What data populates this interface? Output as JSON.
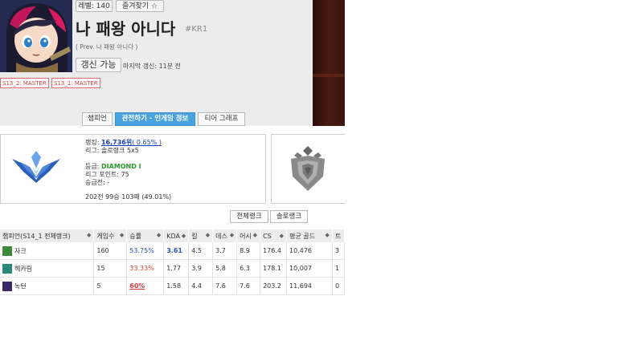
{
  "profile": {
    "level_label": "레벨: 140",
    "favorite_label": "즐겨찾기",
    "favorite_icon": "star-icon",
    "summoner_name": "나 패왕 아니다",
    "tag": "#KR1",
    "prev_name": "( Prev. 나 패왕 아니다 )",
    "refresh_label": "갱신 가능",
    "last_update": "마지막 갱신: 11분 전",
    "season_badges": [
      "S13_2: MASTER",
      "S13_1: MASTER"
    ]
  },
  "tabs": [
    "챔피언",
    "관전하기 - 인게임 정보",
    "티어 그래프"
  ],
  "rank": {
    "ranking_label": "랭킹: ",
    "ranking_value": "16,736위",
    "ranking_pct": "( 0.65% )",
    "league": "리그: 솔로랭크 5x5",
    "tier_label": "등급: ",
    "tier_value": "DIAMOND I",
    "league_points": "리그 포인트: 75",
    "promotion": "승급전: -",
    "record": "202전 99승 103패 (49.01%)"
  },
  "filters": [
    "전체랭크",
    "솔로랭크"
  ],
  "table": {
    "headers": [
      "챔피언(S14_1 전체랭크)",
      "게임수",
      "승률",
      "KDA",
      "킬",
      "데스",
      "어시",
      "CS",
      "평균 골드",
      "트"
    ],
    "rows": [
      {
        "champion": "자크",
        "games": "160",
        "winrate": "53.75%",
        "kda": "3.61",
        "kills": "4.5",
        "deaths": "3.7",
        "assists": "8.9",
        "cs": "176.4",
        "gold": "10,476",
        "extra": "3",
        "icon_color": "#3a8a3a"
      },
      {
        "champion": "헤카림",
        "games": "15",
        "winrate": "33.33%",
        "kda": "1.77",
        "kills": "3.9",
        "deaths": "5.8",
        "assists": "6.3",
        "cs": "178.1",
        "gold": "10,007",
        "extra": "1",
        "icon_color": "#2a8a7a"
      },
      {
        "champion": "녹턴",
        "games": "5",
        "winrate": "60%",
        "kda": "1.58",
        "kills": "4.4",
        "deaths": "7.6",
        "assists": "7.6",
        "cs": "203.2",
        "gold": "11,694",
        "extra": "0",
        "icon_color": "#3a2a6a"
      }
    ]
  }
}
